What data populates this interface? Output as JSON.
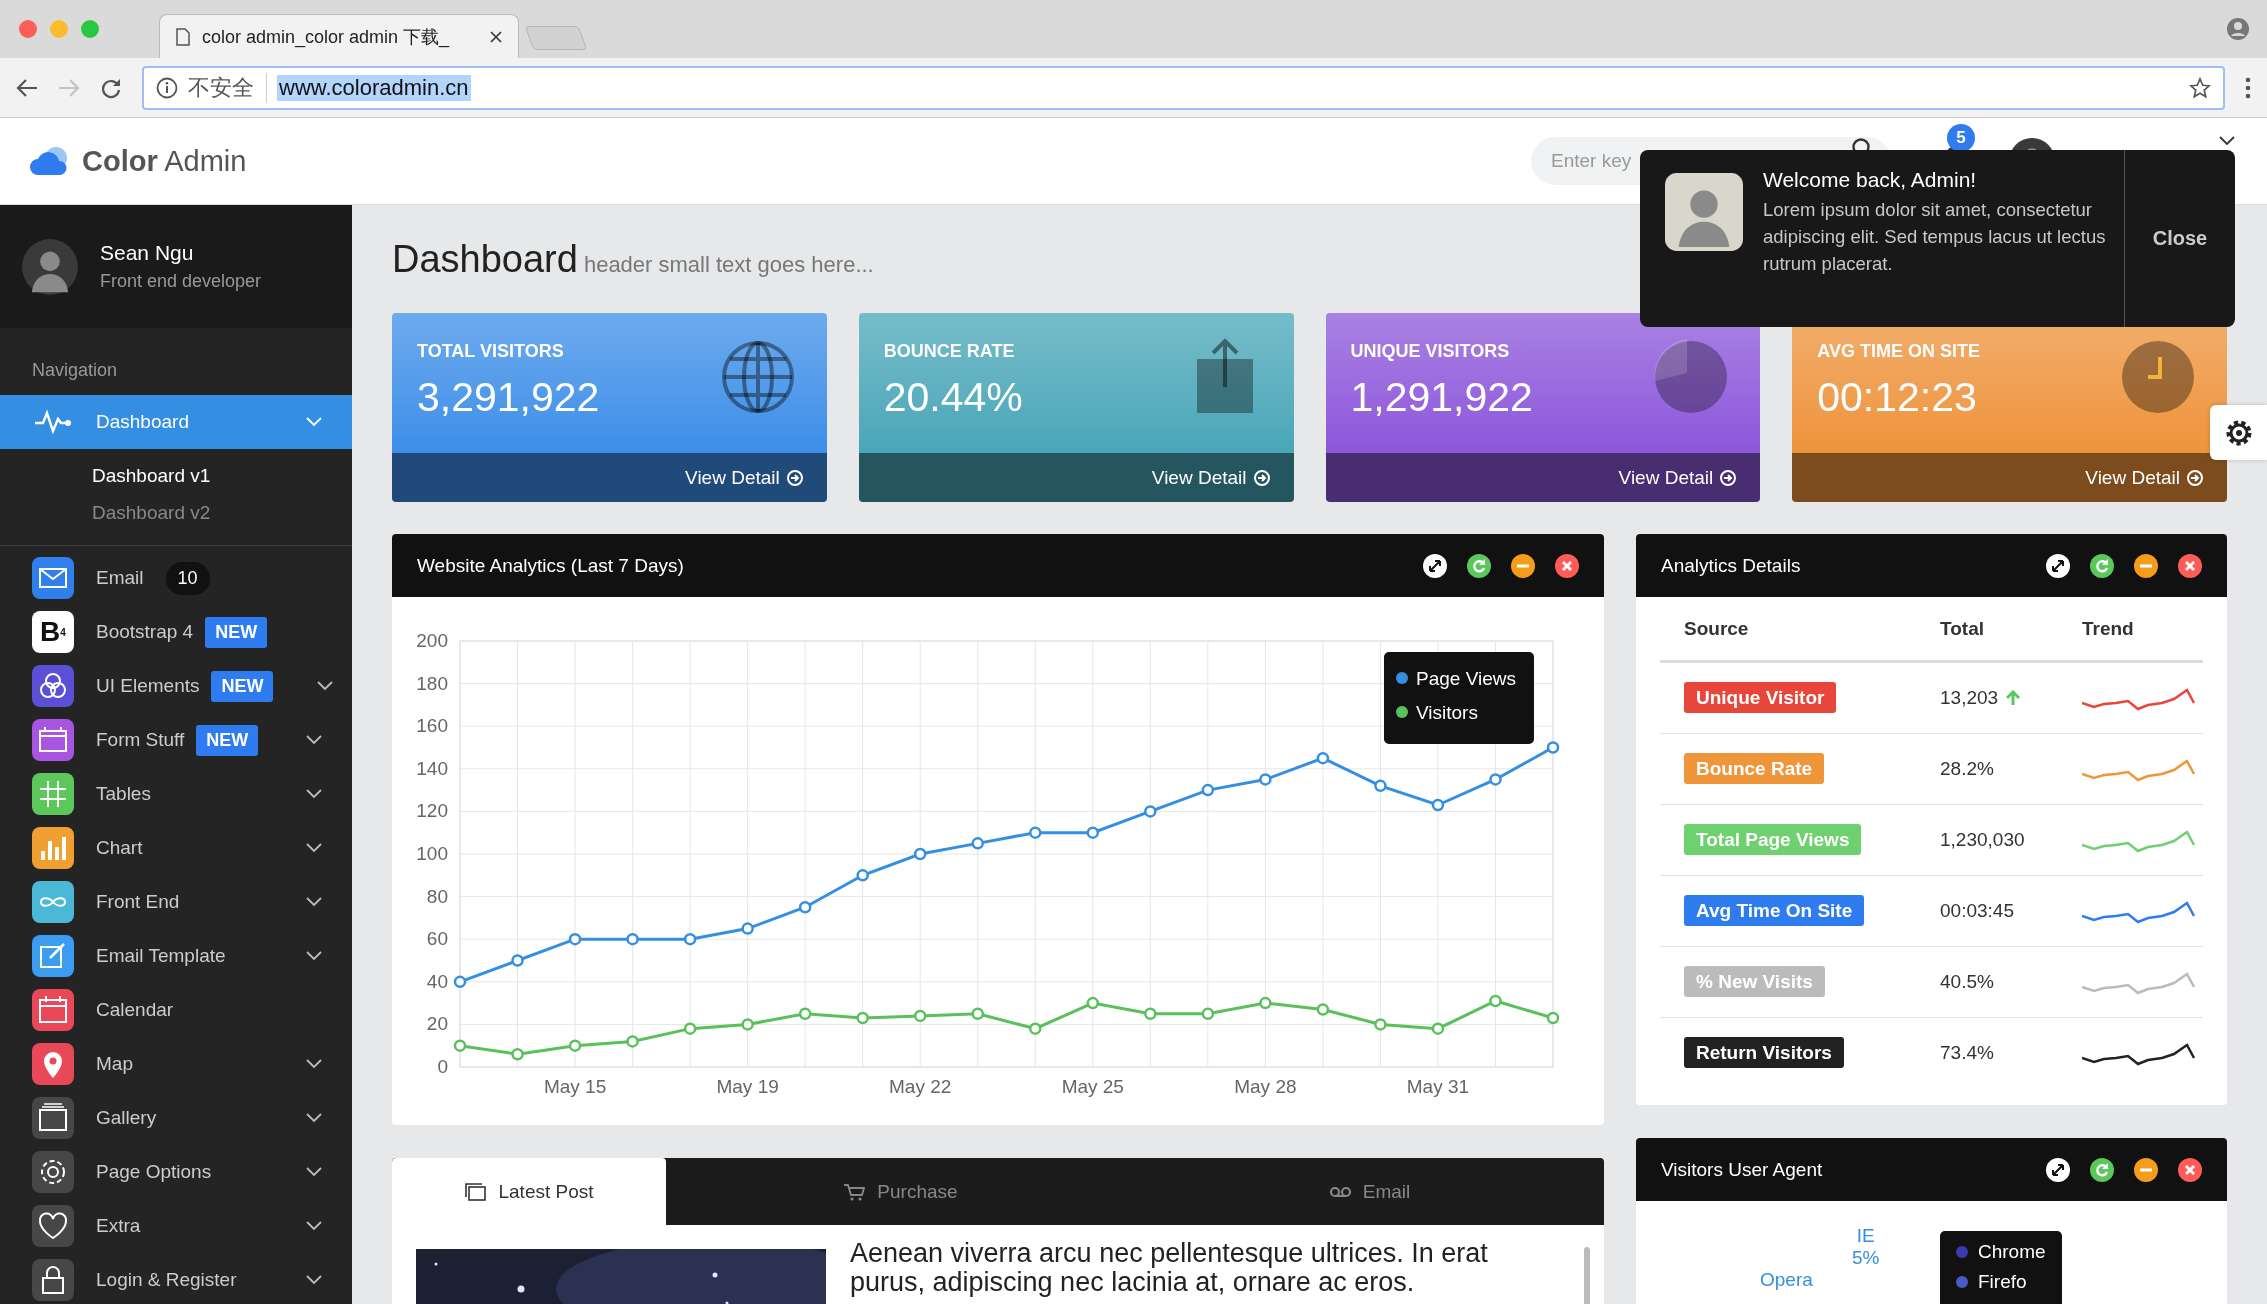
{
  "browser": {
    "tabs": [
      {
        "title": "color admin_color admin 下载_",
        "selected": true
      }
    ],
    "security_label": "不安全",
    "url": "www.coloradmin.cn"
  },
  "header": {
    "brand_bold": "Color",
    "brand_light": "Admin",
    "search": {
      "placeholder": "Enter key"
    },
    "notification_count": "5"
  },
  "notification": {
    "title": "Welcome back, Admin!",
    "message": "Lorem ipsum dolor sit amet, consectetur adipiscing elit. Sed tempus lacus ut lectus rutrum placerat.",
    "close_label": "Close"
  },
  "sidebar": {
    "profile": {
      "name": "Sean Ngu",
      "role": "Front end developer"
    },
    "section_title": "Navigation",
    "items": [
      {
        "label": "Dashboard",
        "selected": true,
        "submenu": true,
        "children": [
          {
            "label": "Dashboard v1",
            "selected": true
          },
          {
            "label": "Dashboard v2",
            "selected": false
          }
        ]
      },
      {
        "label": "Email",
        "selected": false,
        "submenu": false,
        "color": "#2f80ed",
        "badge": {
          "text": "10",
          "kind": "count"
        }
      },
      {
        "label": "Bootstrap 4",
        "selected": false,
        "submenu": false,
        "color": "#ffffff",
        "icon_text": "B$^{4}$",
        "badge": {
          "text": "NEW",
          "kind": "label"
        }
      },
      {
        "label": "UI Elements",
        "selected": false,
        "submenu": true,
        "color": "#5b4fd6",
        "badge": {
          "text": "NEW",
          "kind": "label"
        }
      },
      {
        "label": "Form Stuff",
        "selected": false,
        "submenu": true,
        "color": "#a855e0",
        "badge": {
          "text": "NEW",
          "kind": "label"
        }
      },
      {
        "label": "Tables",
        "selected": false,
        "submenu": true,
        "color": "#5cc85c"
      },
      {
        "label": "Chart",
        "selected": false,
        "submenu": true,
        "color": "#f0a030"
      },
      {
        "label": "Front End",
        "selected": false,
        "submenu": true,
        "color": "#4cb8d8"
      },
      {
        "label": "Email Template",
        "selected": false,
        "submenu": true,
        "color": "#3b9cf0"
      },
      {
        "label": "Calendar",
        "selected": false,
        "submenu": false,
        "color": "#e94858"
      },
      {
        "label": "Map",
        "selected": false,
        "submenu": true,
        "color": "#e94858"
      },
      {
        "label": "Gallery",
        "selected": false,
        "submenu": true,
        "color": "#474747"
      },
      {
        "label": "Page Options",
        "selected": false,
        "submenu": true,
        "color": "#474747"
      },
      {
        "label": "Extra",
        "selected": false,
        "submenu": true,
        "color": "#474747"
      },
      {
        "label": "Login & Register",
        "selected": false,
        "submenu": true,
        "color": "#474747"
      }
    ]
  },
  "page": {
    "title": "Dashboard",
    "subtitle": "header small text goes here..."
  },
  "stats": [
    {
      "label": "TOTAL VISITORS",
      "value": "3,291,922",
      "link": "View Detail",
      "kind": "globe",
      "color": "#3c8ee8"
    },
    {
      "label": "BOUNCE RATE",
      "value": "20.44%",
      "link": "View Detail",
      "kind": "upload",
      "color": "#48a6b8"
    },
    {
      "label": "UNIQUE VISITORS",
      "value": "1,291,922",
      "link": "View Detail",
      "kind": "pie",
      "color": "#8d56da"
    },
    {
      "label": "AVG TIME ON SITE",
      "value": "00:12:23",
      "link": "View Detail",
      "kind": "clock",
      "color": "#ee933a"
    }
  ],
  "analytics": {
    "title": "Website Analytics (Last 7 Days)",
    "chart_data": {
      "type": "line",
      "categories": [
        null,
        null,
        "May 15",
        null,
        null,
        "May 19",
        null,
        null,
        "May 22",
        null,
        null,
        "May 25",
        null,
        null,
        "May 28",
        null,
        null,
        "May 31",
        null,
        null
      ],
      "ylim": [
        0,
        200
      ],
      "yticks": [
        0,
        20,
        40,
        60,
        80,
        100,
        120,
        140,
        160,
        180,
        200
      ],
      "grid": true,
      "legend": true,
      "series": [
        {
          "name": "Page Views",
          "color": "#348fe2",
          "marker": "circle",
          "values": [
            40,
            50,
            60,
            60,
            60,
            65,
            75,
            90,
            100,
            105,
            110,
            110,
            120,
            130,
            135,
            145,
            132,
            123,
            135,
            150
          ]
        },
        {
          "name": "Visitors",
          "color": "#5ac05a",
          "marker": "circle",
          "values": [
            10,
            6,
            10,
            12,
            18,
            20,
            25,
            23,
            24,
            25,
            18,
            30,
            25,
            25,
            30,
            27,
            20,
            18,
            31,
            23
          ]
        }
      ]
    }
  },
  "details": {
    "title": "Analytics Details",
    "columns": [
      "Source",
      "Total",
      "Trend"
    ],
    "rows": [
      {
        "source": "Unique Visitor",
        "total": "13,203",
        "arrow_up": true,
        "color": "#e8463a"
      },
      {
        "source": "Bounce Rate",
        "total": "28.2%",
        "arrow_up": false,
        "color": "#f0963a"
      },
      {
        "source": "Total Page Views",
        "total": "1,230,030",
        "arrow_up": false,
        "color": "#6fd06f"
      },
      {
        "source": "Avg Time On Site",
        "total": "00:03:45",
        "arrow_up": false,
        "color": "#2f7cf0"
      },
      {
        "source": "% New Visits",
        "total": "40.5%",
        "arrow_up": false,
        "color": "#bbbbbb"
      },
      {
        "source": "Return Visitors",
        "total": "73.4%",
        "arrow_up": false,
        "color": "#222222"
      }
    ]
  },
  "posts": {
    "tabs": [
      {
        "label": "Latest Post",
        "selected": true
      },
      {
        "label": "Purchase",
        "selected": false
      },
      {
        "label": "Email",
        "selected": false
      }
    ],
    "post": {
      "kind": "picture",
      "headline": "Aenean viverra arcu nec pellentesque ultrices. In erat purus, adipiscing nec lacinia at, ornare ac eros."
    }
  },
  "user_agent": {
    "title": "Visitors User Agent",
    "pie_labels": [
      {
        "label": "IE",
        "value": "5%"
      },
      {
        "label": "Opera"
      }
    ],
    "legend": [
      {
        "label": "Chrome",
        "color": "#3b3bb0"
      },
      {
        "label": "Firefo",
        "color": "#4a58c8"
      }
    ]
  }
}
